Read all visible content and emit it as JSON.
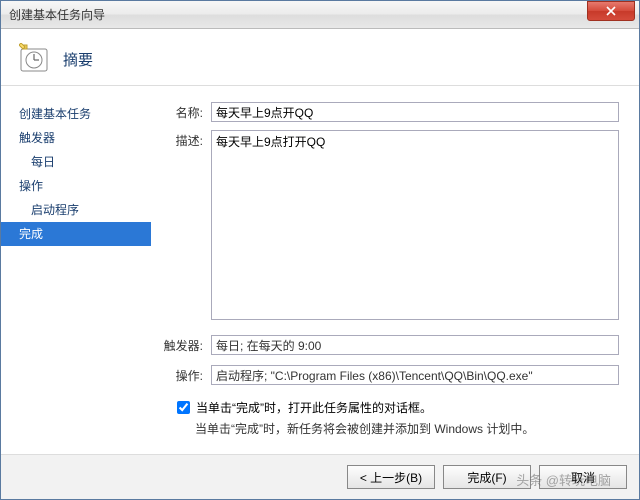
{
  "window": {
    "title": "创建基本任务向导"
  },
  "header": {
    "title": "摘要"
  },
  "sidebar": {
    "items": [
      {
        "label": "创建基本任务",
        "sub": false,
        "selected": false
      },
      {
        "label": "触发器",
        "sub": false,
        "selected": false
      },
      {
        "label": "每日",
        "sub": true,
        "selected": false
      },
      {
        "label": "操作",
        "sub": false,
        "selected": false
      },
      {
        "label": "启动程序",
        "sub": true,
        "selected": false
      },
      {
        "label": "完成",
        "sub": false,
        "selected": true
      }
    ]
  },
  "form": {
    "name_label": "名称:",
    "name_value": "每天早上9点开QQ",
    "desc_label": "描述:",
    "desc_value": "每天早上9点打开QQ",
    "trigger_label": "触发器:",
    "trigger_value": "每日; 在每天的 9:00",
    "action_label": "操作:",
    "action_value": "启动程序; \"C:\\Program Files (x86)\\Tencent\\QQ\\Bin\\QQ.exe\"",
    "checkbox_label": "当单击“完成”时，打开此任务属性的对话框。",
    "info_text": "当单击“完成”时，新任务将会被创建并添加到 Windows 计划中。"
  },
  "footer": {
    "back": "< 上一步(B)",
    "finish": "完成(F)",
    "cancel": "取消"
  },
  "watermark": "头条 @转玩电脑"
}
